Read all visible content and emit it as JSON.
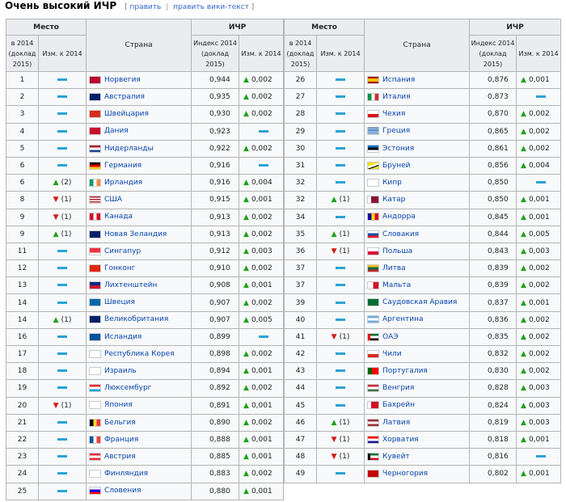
{
  "page": {
    "title": "Очень высокий ИЧР",
    "edit_label": "править",
    "edit_wiki_label": "править вики-текст",
    "bracket_open": "[",
    "bracket_close": "]",
    "separator": "|"
  },
  "headers": {
    "place": "Место",
    "country": "Страна",
    "hdi": "ИЧР",
    "rank_in_2014": "в 2014 (доклад 2015)",
    "change_2014": "Изм. к 2014",
    "index_2014": "Индекс 2014 (доклад 2015)",
    "delta_2014": "Изм. к 2014"
  },
  "colors": {
    "up": "#1ea11e",
    "down": "#d11a1a",
    "same": "#29a3d6",
    "link": "#0645ad"
  },
  "left_rows": [
    {
      "rank": "1",
      "chg": "same",
      "chg_num": "",
      "country": "Норвегия",
      "flag": "NO",
      "hdi": "0,944",
      "dlt": "up",
      "dlt_val": "0,002"
    },
    {
      "rank": "2",
      "chg": "same",
      "chg_num": "",
      "country": "Австралия",
      "flag": "AU",
      "hdi": "0,935",
      "dlt": "up",
      "dlt_val": "0,002"
    },
    {
      "rank": "3",
      "chg": "same",
      "chg_num": "",
      "country": "Швейцария",
      "flag": "CH",
      "hdi": "0,930",
      "dlt": "up",
      "dlt_val": "0,002"
    },
    {
      "rank": "4",
      "chg": "same",
      "chg_num": "",
      "country": "Дания",
      "flag": "DK",
      "hdi": "0,923",
      "dlt": "same",
      "dlt_val": ""
    },
    {
      "rank": "5",
      "chg": "same",
      "chg_num": "",
      "country": "Нидерланды",
      "flag": "NL",
      "hdi": "0,922",
      "dlt": "up",
      "dlt_val": "0,002"
    },
    {
      "rank": "6",
      "chg": "same",
      "chg_num": "",
      "country": "Германия",
      "flag": "DE",
      "hdi": "0,916",
      "dlt": "same",
      "dlt_val": ""
    },
    {
      "rank": "6",
      "chg": "up",
      "chg_num": "(2)",
      "country": "Ирландия",
      "flag": "IE",
      "hdi": "0,916",
      "dlt": "up",
      "dlt_val": "0,004"
    },
    {
      "rank": "8",
      "chg": "down",
      "chg_num": "(1)",
      "country": "США",
      "flag": "US",
      "hdi": "0,915",
      "dlt": "up",
      "dlt_val": "0,001"
    },
    {
      "rank": "9",
      "chg": "down",
      "chg_num": "(1)",
      "country": "Канада",
      "flag": "CA",
      "hdi": "0,913",
      "dlt": "up",
      "dlt_val": "0,002"
    },
    {
      "rank": "9",
      "chg": "up",
      "chg_num": "(1)",
      "country": "Новая Зеландия",
      "flag": "NZ",
      "hdi": "0,913",
      "dlt": "up",
      "dlt_val": "0,002"
    },
    {
      "rank": "11",
      "chg": "same",
      "chg_num": "",
      "country": "Сингапур",
      "flag": "SG",
      "hdi": "0,912",
      "dlt": "up",
      "dlt_val": "0,003"
    },
    {
      "rank": "12",
      "chg": "same",
      "chg_num": "",
      "country": "Гонконг",
      "flag": "HK",
      "hdi": "0,910",
      "dlt": "up",
      "dlt_val": "0,002"
    },
    {
      "rank": "13",
      "chg": "same",
      "chg_num": "",
      "country": "Лихтенштейн",
      "flag": "LI",
      "hdi": "0,908",
      "dlt": "up",
      "dlt_val": "0,001"
    },
    {
      "rank": "14",
      "chg": "same",
      "chg_num": "",
      "country": "Швеция",
      "flag": "SE",
      "hdi": "0,907",
      "dlt": "up",
      "dlt_val": "0,002"
    },
    {
      "rank": "14",
      "chg": "up",
      "chg_num": "(1)",
      "country": "Великобритания",
      "flag": "GB",
      "hdi": "0,907",
      "dlt": "up",
      "dlt_val": "0,005"
    },
    {
      "rank": "16",
      "chg": "same",
      "chg_num": "",
      "country": "Исландия",
      "flag": "IS",
      "hdi": "0,899",
      "dlt": "same",
      "dlt_val": ""
    },
    {
      "rank": "17",
      "chg": "same",
      "chg_num": "",
      "country": "Республика Корея",
      "flag": "KR",
      "hdi": "0,898",
      "dlt": "up",
      "dlt_val": "0,002"
    },
    {
      "rank": "18",
      "chg": "same",
      "chg_num": "",
      "country": "Израиль",
      "flag": "IL",
      "hdi": "0,894",
      "dlt": "up",
      "dlt_val": "0,001"
    },
    {
      "rank": "19",
      "chg": "same",
      "chg_num": "",
      "country": "Люксембург",
      "flag": "LU",
      "hdi": "0,892",
      "dlt": "up",
      "dlt_val": "0,002"
    },
    {
      "rank": "20",
      "chg": "down",
      "chg_num": "(1)",
      "country": "Япония",
      "flag": "JP",
      "hdi": "0,891",
      "dlt": "up",
      "dlt_val": "0,001"
    },
    {
      "rank": "21",
      "chg": "same",
      "chg_num": "",
      "country": "Бельгия",
      "flag": "BE",
      "hdi": "0,890",
      "dlt": "up",
      "dlt_val": "0,002"
    },
    {
      "rank": "22",
      "chg": "same",
      "chg_num": "",
      "country": "Франция",
      "flag": "FR",
      "hdi": "0,888",
      "dlt": "up",
      "dlt_val": "0,001"
    },
    {
      "rank": "23",
      "chg": "same",
      "chg_num": "",
      "country": "Австрия",
      "flag": "AT",
      "hdi": "0,885",
      "dlt": "up",
      "dlt_val": "0,001"
    },
    {
      "rank": "24",
      "chg": "same",
      "chg_num": "",
      "country": "Финляндия",
      "flag": "FI",
      "hdi": "0,883",
      "dlt": "up",
      "dlt_val": "0,002"
    },
    {
      "rank": "25",
      "chg": "same",
      "chg_num": "",
      "country": "Словения",
      "flag": "SI",
      "hdi": "0,880",
      "dlt": "up",
      "dlt_val": "0,001"
    }
  ],
  "right_rows": [
    {
      "rank": "26",
      "chg": "same",
      "chg_num": "",
      "country": "Испания",
      "flag": "ES",
      "hdi": "0,876",
      "dlt": "up",
      "dlt_val": "0,001"
    },
    {
      "rank": "27",
      "chg": "same",
      "chg_num": "",
      "country": "Италия",
      "flag": "IT",
      "hdi": "0,873",
      "dlt": "same",
      "dlt_val": ""
    },
    {
      "rank": "28",
      "chg": "same",
      "chg_num": "",
      "country": "Чехия",
      "flag": "CZ",
      "hdi": "0,870",
      "dlt": "up",
      "dlt_val": "0,002"
    },
    {
      "rank": "29",
      "chg": "same",
      "chg_num": "",
      "country": "Греция",
      "flag": "GR",
      "hdi": "0,865",
      "dlt": "up",
      "dlt_val": "0,002"
    },
    {
      "rank": "30",
      "chg": "same",
      "chg_num": "",
      "country": "Эстония",
      "flag": "EE",
      "hdi": "0,861",
      "dlt": "up",
      "dlt_val": "0,002"
    },
    {
      "rank": "31",
      "chg": "same",
      "chg_num": "",
      "country": "Бруней",
      "flag": "BN",
      "hdi": "0,856",
      "dlt": "up",
      "dlt_val": "0,004"
    },
    {
      "rank": "32",
      "chg": "same",
      "chg_num": "",
      "country": "Кипр",
      "flag": "CY",
      "hdi": "0,850",
      "dlt": "same",
      "dlt_val": ""
    },
    {
      "rank": "32",
      "chg": "up",
      "chg_num": "(1)",
      "country": "Катар",
      "flag": "QA",
      "hdi": "0,850",
      "dlt": "up",
      "dlt_val": "0,001"
    },
    {
      "rank": "34",
      "chg": "same",
      "chg_num": "",
      "country": "Андорра",
      "flag": "AD",
      "hdi": "0,845",
      "dlt": "up",
      "dlt_val": "0,001"
    },
    {
      "rank": "35",
      "chg": "up",
      "chg_num": "(1)",
      "country": "Словакия",
      "flag": "SK",
      "hdi": "0,844",
      "dlt": "up",
      "dlt_val": "0,005"
    },
    {
      "rank": "36",
      "chg": "down",
      "chg_num": "(1)",
      "country": "Польша",
      "flag": "PL",
      "hdi": "0,843",
      "dlt": "up",
      "dlt_val": "0,003"
    },
    {
      "rank": "37",
      "chg": "same",
      "chg_num": "",
      "country": "Литва",
      "flag": "LT",
      "hdi": "0,839",
      "dlt": "up",
      "dlt_val": "0,002"
    },
    {
      "rank": "37",
      "chg": "same",
      "chg_num": "",
      "country": "Мальта",
      "flag": "MT",
      "hdi": "0,839",
      "dlt": "up",
      "dlt_val": "0,002"
    },
    {
      "rank": "39",
      "chg": "same",
      "chg_num": "",
      "country": "Саудовская Аравия",
      "flag": "SA",
      "hdi": "0,837",
      "dlt": "up",
      "dlt_val": "0,001"
    },
    {
      "rank": "40",
      "chg": "same",
      "chg_num": "",
      "country": "Аргентина",
      "flag": "AR",
      "hdi": "0,836",
      "dlt": "up",
      "dlt_val": "0,002"
    },
    {
      "rank": "41",
      "chg": "down",
      "chg_num": "(1)",
      "country": "ОАЭ",
      "flag": "AE",
      "hdi": "0,835",
      "dlt": "up",
      "dlt_val": "0,002"
    },
    {
      "rank": "42",
      "chg": "same",
      "chg_num": "",
      "country": "Чили",
      "flag": "CL",
      "hdi": "0,832",
      "dlt": "up",
      "dlt_val": "0,002"
    },
    {
      "rank": "43",
      "chg": "same",
      "chg_num": "",
      "country": "Португалия",
      "flag": "PT",
      "hdi": "0,830",
      "dlt": "up",
      "dlt_val": "0,002"
    },
    {
      "rank": "44",
      "chg": "same",
      "chg_num": "",
      "country": "Венгрия",
      "flag": "HU",
      "hdi": "0,828",
      "dlt": "up",
      "dlt_val": "0,003"
    },
    {
      "rank": "45",
      "chg": "same",
      "chg_num": "",
      "country": "Бахрейн",
      "flag": "BH",
      "hdi": "0,824",
      "dlt": "up",
      "dlt_val": "0,003"
    },
    {
      "rank": "46",
      "chg": "up",
      "chg_num": "(1)",
      "country": "Латвия",
      "flag": "LV",
      "hdi": "0,819",
      "dlt": "up",
      "dlt_val": "0,003"
    },
    {
      "rank": "47",
      "chg": "down",
      "chg_num": "(1)",
      "country": "Хорватия",
      "flag": "HR",
      "hdi": "0,818",
      "dlt": "up",
      "dlt_val": "0,001"
    },
    {
      "rank": "48",
      "chg": "down",
      "chg_num": "(1)",
      "country": "Кувейт",
      "flag": "KW",
      "hdi": "0,816",
      "dlt": "same",
      "dlt_val": ""
    },
    {
      "rank": "49",
      "chg": "same",
      "chg_num": "",
      "country": "Черногория",
      "flag": "ME",
      "hdi": "0,802",
      "dlt": "up",
      "dlt_val": "0,001"
    }
  ]
}
